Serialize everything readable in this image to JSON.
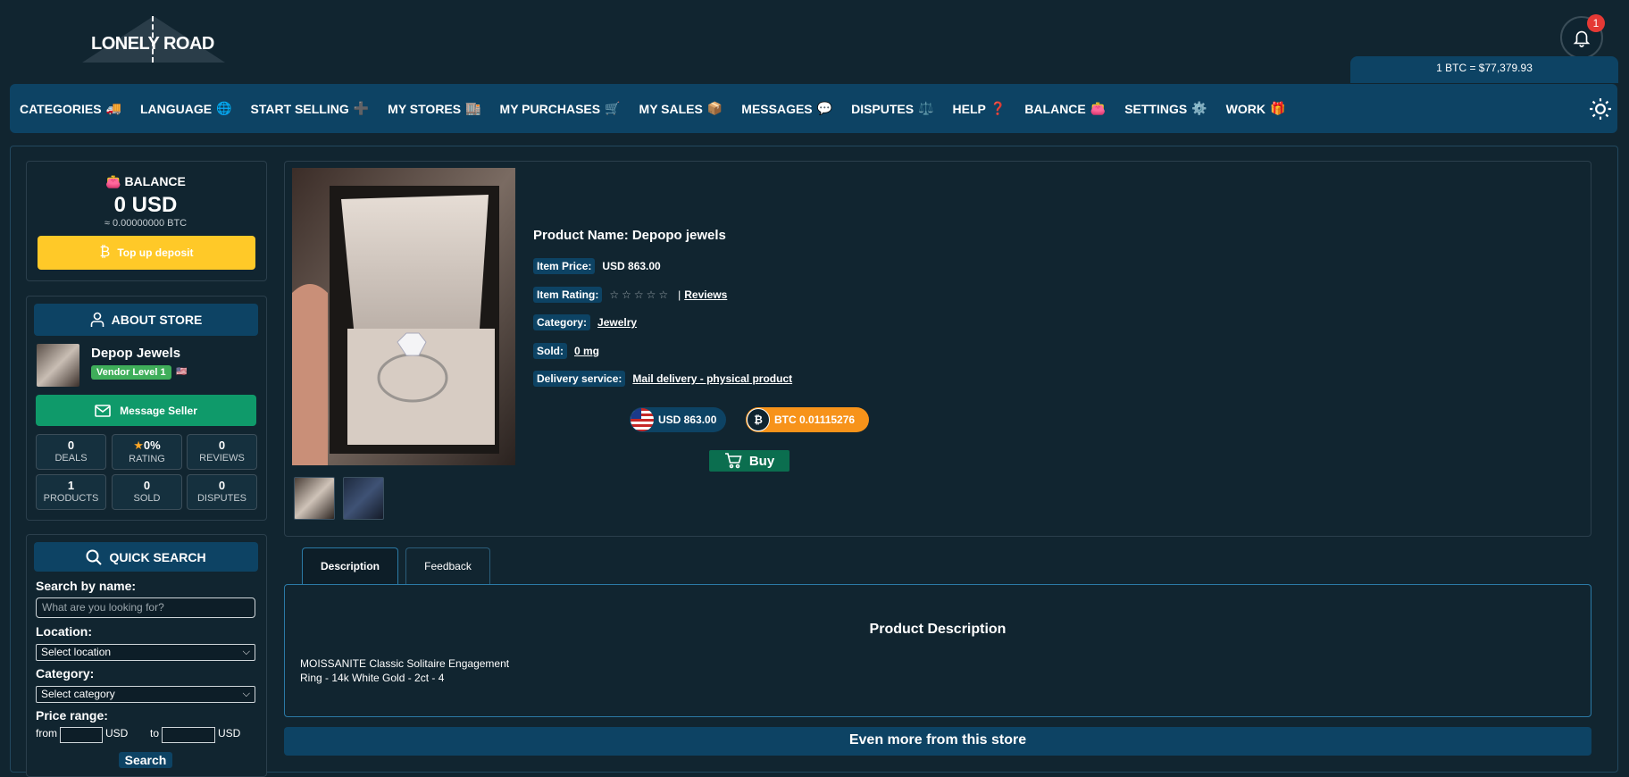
{
  "header": {
    "logo_text": "LONELY ROAD",
    "notification_count": "1",
    "btc_rate": "1 BTC = $77,379.93"
  },
  "nav": {
    "items": [
      {
        "label": "CATEGORIES",
        "icon": "🚚"
      },
      {
        "label": "LANGUAGE",
        "icon": "🌐"
      },
      {
        "label": "START SELLING",
        "icon": "➕"
      },
      {
        "label": "MY STORES",
        "icon": "🏬"
      },
      {
        "label": "MY PURCHASES",
        "icon": "🛒"
      },
      {
        "label": "MY SALES",
        "icon": "📦"
      },
      {
        "label": "MESSAGES",
        "icon": "💬"
      },
      {
        "label": "DISPUTES",
        "icon": "⚖️"
      },
      {
        "label": "HELP",
        "icon": "❓"
      },
      {
        "label": "BALANCE",
        "icon": "👛"
      },
      {
        "label": "SETTINGS",
        "icon": "⚙️"
      },
      {
        "label": "WORK",
        "icon": "🎁"
      }
    ]
  },
  "balance": {
    "icon": "👛",
    "title": "BALANCE",
    "usd": "0 USD",
    "btc": "≈ 0.00000000 BTC",
    "topup_icon": "₿",
    "topup_label": "Top up deposit"
  },
  "about": {
    "title": "ABOUT STORE",
    "store_name": "Depop Jewels",
    "vendor_level": "Vendor Level 1",
    "flag": "🇺🇸",
    "message_label": "Message Seller",
    "stats": [
      {
        "value": "0",
        "label": "DEALS"
      },
      {
        "value": "0%",
        "label": "RATING",
        "icon": "★"
      },
      {
        "value": "0",
        "label": "REVIEWS"
      },
      {
        "value": "1",
        "label": "PRODUCTS"
      },
      {
        "value": "0",
        "label": "SOLD"
      },
      {
        "value": "0",
        "label": "DISPUTES"
      }
    ]
  },
  "search": {
    "title": "QUICK SEARCH",
    "name_label": "Search by name:",
    "name_placeholder": "What are you looking for?",
    "location_label": "Location:",
    "location_value": "Select location",
    "category_label": "Category:",
    "category_value": "Select category",
    "price_label": "Price range:",
    "from_label": "from",
    "to_label": "to",
    "currency": "USD",
    "button_label": "Search"
  },
  "product": {
    "name": "Product Name: Depopo jewels",
    "price_label": "Item Price:",
    "price_value": "USD 863.00",
    "rating_label": "Item Rating:",
    "rating_stars": "☆☆☆☆☆",
    "rating_sep": "|",
    "reviews_link": "Reviews",
    "category_label": "Category:",
    "category_value": "Jewelry",
    "sold_label": "Sold:",
    "sold_value": "0 mg",
    "delivery_label": "Delivery service:",
    "delivery_value": "Mail delivery - physical product",
    "usd_pill": "USD 863.00",
    "btc_pill": "BTC 0.01115276",
    "btc_symbol": "₿",
    "buy_label": "Buy"
  },
  "tabs": [
    {
      "label": "Description",
      "active": true
    },
    {
      "label": "Feedback",
      "active": false
    }
  ],
  "description": {
    "title": "Product Description",
    "text": "MOISSANITE Classic Solitaire Engagement Ring - 14k White Gold - 2ct - 4"
  },
  "more_title": "Even more from this store",
  "colors": {
    "nav_bg": "#0d4364",
    "page_bg": "#112530",
    "topup": "#ffc928",
    "message": "#0f9a6a",
    "vendor_badge": "#3fae5a",
    "btc": "#f7931a",
    "buy": "#0b6e4f"
  }
}
